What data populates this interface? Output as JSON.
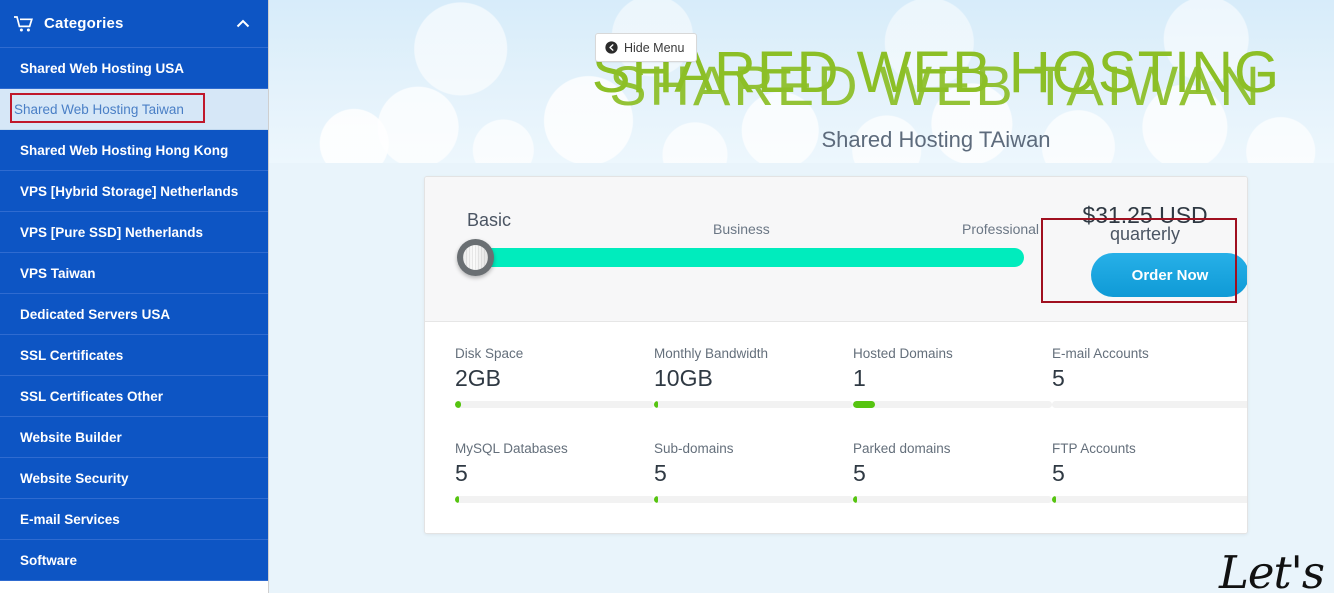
{
  "sidebar": {
    "header": {
      "title": "Categories",
      "cart_icon": "cart-icon",
      "collapse_icon": "chevron-up-icon"
    },
    "items": [
      {
        "label": "Shared Web Hosting USA",
        "active": false
      },
      {
        "label": "Shared Web Hosting Taiwan",
        "active": true
      },
      {
        "label": "Shared Web Hosting Hong Kong",
        "active": false
      },
      {
        "label": "VPS [Hybrid Storage] Netherlands",
        "active": false
      },
      {
        "label": "VPS [Pure SSD] Netherlands",
        "active": false
      },
      {
        "label": "VPS Taiwan",
        "active": false
      },
      {
        "label": "Dedicated Servers USA",
        "active": false
      },
      {
        "label": "SSL Certificates",
        "active": false
      },
      {
        "label": "SSL Certificates Other",
        "active": false
      },
      {
        "label": "Website Builder",
        "active": false
      },
      {
        "label": "Website Security",
        "active": false
      },
      {
        "label": "E-mail Services",
        "active": false
      },
      {
        "label": "Software",
        "active": false
      }
    ],
    "colors": {
      "bg": "#0d55c4",
      "active_bg": "#d6e7f7",
      "active_text": "#4a7fc6"
    }
  },
  "banner": {
    "hide_menu_label": "Hide Menu",
    "hide_menu_icon": "back-arrow-circle-icon",
    "title": "SHARED WEB HOSTING",
    "title_overlap": "SHARED WEB TAIWAN",
    "subtitle": "Shared Hosting TAiwan",
    "title_color": "#8cbf26",
    "subtitle_color": "#5d6b7c"
  },
  "product": {
    "slider": {
      "tiers": [
        "Basic",
        "Business",
        "Professional"
      ],
      "selected_tier": "Basic",
      "position_percent": 0,
      "track_color": "#00ecbd"
    },
    "price": "$31.25 USD",
    "billing_cycle": "quarterly",
    "order_label": "Order Now",
    "order_color": "#0f9ad6",
    "features": [
      {
        "label": "Disk Space",
        "value": "2GB",
        "fill_percent": 3
      },
      {
        "label": "Monthly Bandwidth",
        "value": "10GB",
        "fill_percent": 2
      },
      {
        "label": "Hosted Domains",
        "value": "1",
        "fill_percent": 11
      },
      {
        "label": "E-mail Accounts",
        "value": "5",
        "fill_percent": 0
      },
      {
        "label": "MySQL Databases",
        "value": "5",
        "fill_percent": 2
      },
      {
        "label": "Sub-domains",
        "value": "5",
        "fill_percent": 2
      },
      {
        "label": "Parked domains",
        "value": "5",
        "fill_percent": 2
      },
      {
        "label": "FTP Accounts",
        "value": "5",
        "fill_percent": 2
      }
    ],
    "bar_fill_color": "#56c410"
  },
  "watermark": {
    "text": "Let's"
  },
  "annotations": {
    "sidebar_box_color": "#c0182b",
    "order_box_color": "#a01020"
  }
}
